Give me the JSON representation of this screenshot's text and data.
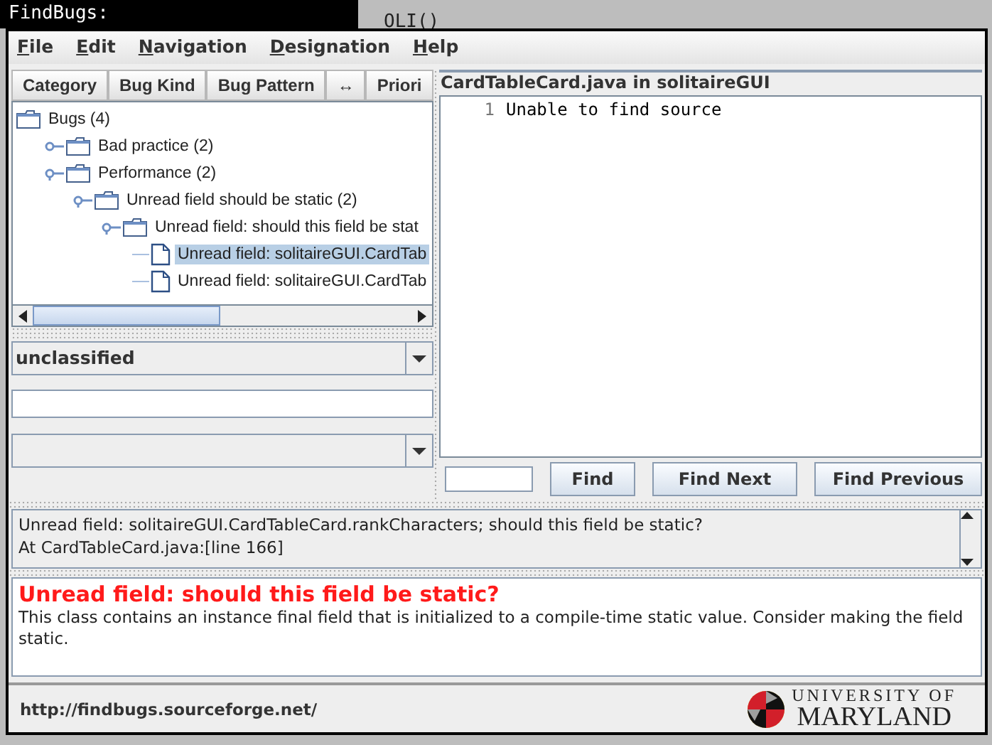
{
  "desktop": {
    "terminal_title": "FindBugs:",
    "background_text": "OLI()"
  },
  "menu": [
    "File",
    "Edit",
    "Navigation",
    "Designation",
    "Help"
  ],
  "sort_buttons": [
    "Category",
    "Bug Kind",
    "Bug Pattern",
    "↔",
    "Priori"
  ],
  "tree": [
    {
      "label": "Bugs (4)",
      "kind": "folder",
      "selected": false,
      "children": [
        {
          "label": "Bad practice (2)",
          "kind": "folder",
          "selected": false,
          "expanded": false
        },
        {
          "label": "Performance (2)",
          "kind": "folder",
          "selected": false,
          "expanded": true,
          "children": [
            {
              "label": "Unread field should be static (2)",
              "kind": "folder",
              "selected": false,
              "expanded": true,
              "children": [
                {
                  "label": "Unread field: should this field be stat",
                  "kind": "folder",
                  "selected": false,
                  "expanded": true,
                  "children": [
                    {
                      "label": "Unread field: solitaireGUI.CardTab",
                      "kind": "file",
                      "selected": true
                    },
                    {
                      "label": "Unread field: solitaireGUI.CardTab",
                      "kind": "file",
                      "selected": false
                    }
                  ]
                }
              ]
            }
          ]
        }
      ]
    }
  ],
  "designation": {
    "value": "unclassified"
  },
  "source": {
    "title": "CardTableCard.java in solitaireGUI",
    "lines": [
      {
        "number": "1",
        "text": "Unable to find source"
      }
    ]
  },
  "find_buttons": [
    "Find",
    "Find Next",
    "Find Previous"
  ],
  "summary": [
    "Unread field: solitaireGUI.CardTableCard.rankCharacters; should this field be static?",
    "At CardTableCard.java:[line 166]"
  ],
  "details": {
    "title": "Unread field: should this field be static?",
    "body": "This class contains an instance final field that is initialized to a compile-time static value. Consider making the field static."
  },
  "footer": {
    "link": "http://findbugs.sourceforge.net/",
    "logo_top": "UNIVERSITY OF",
    "logo_bottom": "MARYLAND"
  }
}
